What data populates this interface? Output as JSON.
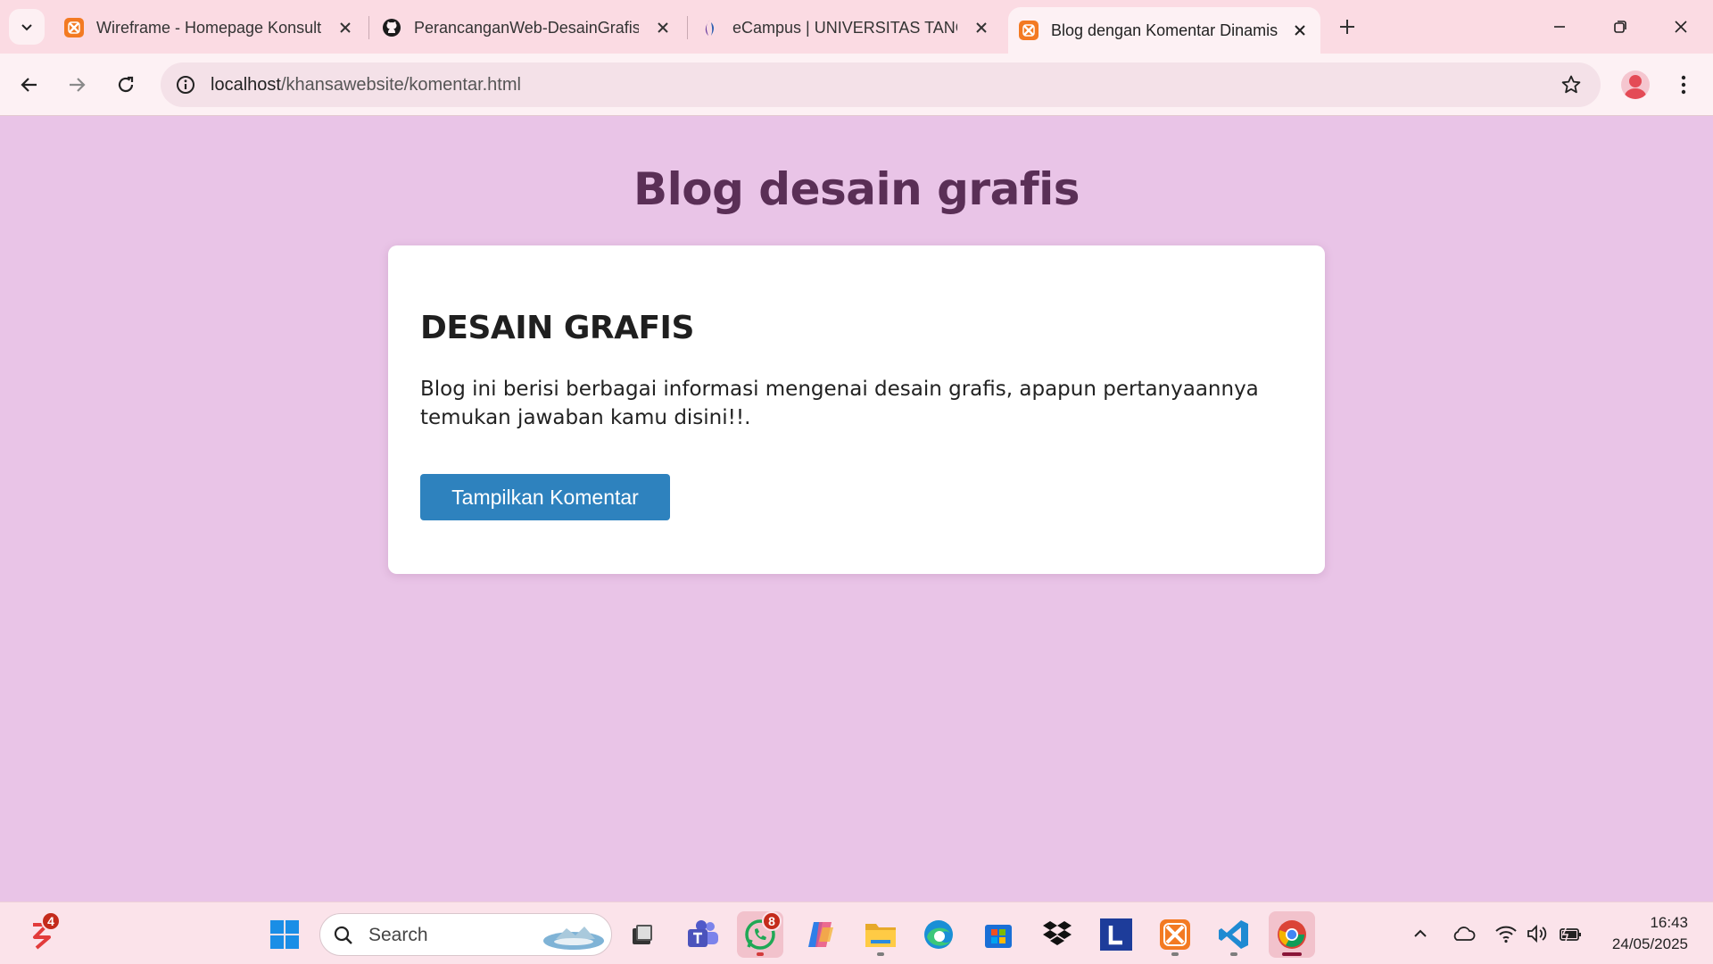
{
  "browser": {
    "tabs": [
      {
        "title": "Wireframe - Homepage Konsult",
        "favicon": "xampp-icon"
      },
      {
        "title": "PerancanganWeb-DesainGrafis",
        "favicon": "github-icon"
      },
      {
        "title": "eCampus | UNIVERSITAS TANGE",
        "favicon": "ecampus-icon"
      },
      {
        "title": "Blog dengan Komentar Dinamis",
        "favicon": "xampp-icon",
        "active": true
      }
    ],
    "url_host": "localhost",
    "url_path": "/khansawebsite/komentar.html"
  },
  "page": {
    "title": "Blog desain grafis",
    "card": {
      "heading": "DESAIN GRAFIS",
      "text": "Blog ini berisi berbagai informasi mengenai desain grafis, apapun pertanyaannya temukan jawaban kamu disini!!.",
      "button_label": "Tampilkan Komentar"
    }
  },
  "taskbar": {
    "search_placeholder": "Search",
    "left_app_badge": "4",
    "whatsapp_badge": "8",
    "apps": [
      "file-viewer-icon",
      "teams-icon",
      "whatsapp-icon",
      "copilot-icon",
      "file-explorer-icon",
      "edge-icon",
      "microsoft-store-icon",
      "dropbox-icon",
      "l-app-icon",
      "xampp-icon",
      "vscode-icon",
      "chrome-icon"
    ],
    "time": "16:43",
    "date": "24/05/2025"
  },
  "colors": {
    "page_bg": "#e9c4e7",
    "title_color": "#5a2f56",
    "button_bg": "#2e82be",
    "tabbar_bg": "#fbdbe3"
  }
}
